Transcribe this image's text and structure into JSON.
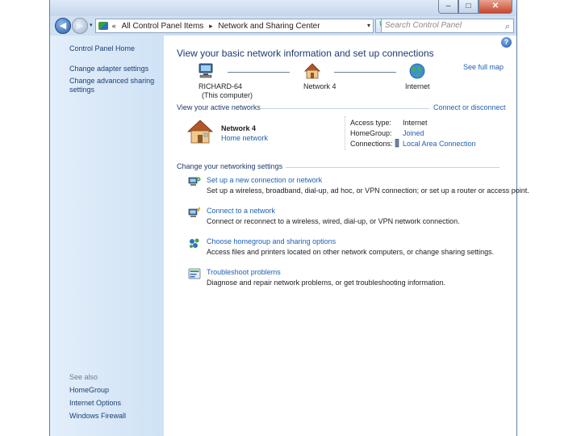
{
  "window": {
    "caption_buttons": {
      "minimize": "–",
      "maximize": "□",
      "close": "✕"
    }
  },
  "navbar": {
    "back_glyph": "◀",
    "forward_glyph": "▶",
    "address_chevron": "«",
    "breadcrumbs": [
      "All Control Panel Items",
      "Network and Sharing Center"
    ],
    "crumb_separator": "▸",
    "dropdown_glyph": "▾",
    "refresh_glyph": "↻",
    "search_placeholder": "Search Control Panel",
    "search_glyph": "⌕"
  },
  "sidebar": {
    "home": "Control Panel Home",
    "links": [
      "Change adapter settings",
      "Change advanced sharing settings"
    ],
    "see_also_label": "See also",
    "see_also": [
      "HomeGroup",
      "Internet Options",
      "Windows Firewall"
    ]
  },
  "main": {
    "help_glyph": "?",
    "heading": "View your basic network information and set up connections",
    "see_full_map": "See full map",
    "map": {
      "computer_name": "RICHARD-64",
      "computer_note": "(This computer)",
      "network": "Network 4",
      "internet": "Internet"
    },
    "active_networks_title": "View your active networks",
    "connect_disconnect": "Connect or disconnect",
    "network": {
      "name": "Network 4",
      "type": "Home network",
      "access_type_label": "Access type:",
      "access_type_value": "Internet",
      "homegroup_label": "HomeGroup:",
      "homegroup_value": "Joined",
      "connections_label": "Connections:",
      "connections_value": "Local Area Connection"
    },
    "change_settings_title": "Change your networking settings",
    "tasks": [
      {
        "title": "Set up a new connection or network",
        "desc": "Set up a wireless, broadband, dial-up, ad hoc, or VPN connection; or set up a router or access point.",
        "icon": "new-connection-icon"
      },
      {
        "title": "Connect to a network",
        "desc": "Connect or reconnect to a wireless, wired, dial-up, or VPN network connection.",
        "icon": "connect-network-icon"
      },
      {
        "title": "Choose homegroup and sharing options",
        "desc": "Access files and printers located on other network computers, or change sharing settings.",
        "icon": "homegroup-icon"
      },
      {
        "title": "Troubleshoot problems",
        "desc": "Diagnose and repair network problems, or get troubleshooting information.",
        "icon": "troubleshoot-icon"
      }
    ]
  }
}
